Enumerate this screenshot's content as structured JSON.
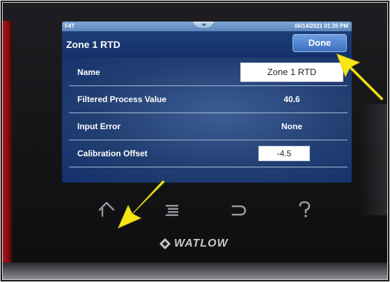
{
  "status_bar": {
    "brand": "F4T",
    "datetime": "06/14/2021 01:35 PM"
  },
  "header": {
    "title": "Zone 1 RTD",
    "done_label": "Done"
  },
  "parameters": [
    {
      "label": "Name",
      "value": "Zone 1 RTD",
      "editable": true
    },
    {
      "label": "Filtered Process Value",
      "value": "40.6",
      "editable": false
    },
    {
      "label": "Input Error",
      "value": "None",
      "editable": false
    },
    {
      "label": "Calibration Offset",
      "value": "-4.5",
      "editable": true
    }
  ],
  "nav_buttons": [
    "home-icon",
    "menu-icon",
    "back-icon",
    "help-icon"
  ],
  "brand_logo": "WATLOW",
  "annotations": {
    "arrow_color": "#f6e613"
  }
}
